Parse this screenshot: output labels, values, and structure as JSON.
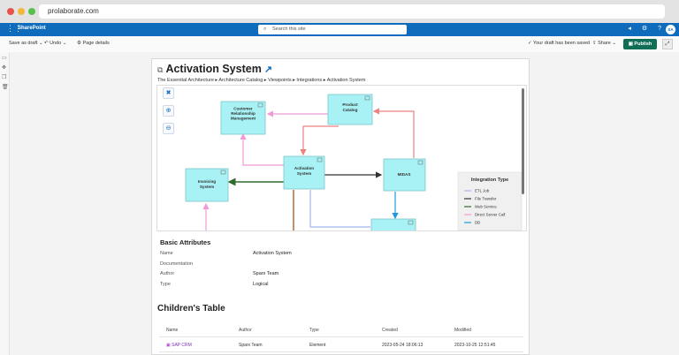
{
  "browser": {
    "url": "prolaborate.com",
    "colors": [
      "#e9524a",
      "#f0b73a",
      "#57c14d"
    ]
  },
  "suite": {
    "app_name": "SharePoint",
    "search_placeholder": "Search this site",
    "avatar": "SA"
  },
  "command_bar": {
    "save_as_draft": "Save as draft",
    "undo": "Undo",
    "page_details": "Page details",
    "draft_status": "Your draft has been saved",
    "share": "Share",
    "publish": "Publish"
  },
  "page": {
    "title": "Activation System",
    "breadcrumb": [
      "The Essential Architecture",
      "Architecture Catalog",
      "Viewpoints",
      "Integrations",
      "Activation System"
    ]
  },
  "diagram": {
    "nodes": [
      "Customer Relationship Management",
      "Product Catalog",
      "Activation System",
      "Invoicing System",
      "MIDAS"
    ],
    "legend": {
      "title": "Integration Type",
      "items": [
        {
          "label": "ETL Job",
          "color": "#9fb7e6"
        },
        {
          "label": "File Transfer",
          "color": "#333333"
        },
        {
          "label": "Web Service",
          "color": "#2e6b2e"
        },
        {
          "label": "Direct Server Call",
          "color": "#f09ad8"
        },
        {
          "label": "DB",
          "color": "#1e9be0"
        }
      ]
    }
  },
  "basic_attributes": {
    "heading": "Basic Attributes",
    "rows": [
      {
        "label": "Name",
        "value": "Activation System"
      },
      {
        "label": "Documentation",
        "value": ""
      },
      {
        "label": "Author",
        "value": "Sparx Team"
      },
      {
        "label": "Type",
        "value": "Logical"
      }
    ]
  },
  "children_table": {
    "heading": "Children's Table",
    "columns": [
      "Name",
      "Author",
      "Type",
      "Created",
      "Modified"
    ],
    "rows": [
      [
        "SAP CRM",
        "Sparx Team",
        "Element",
        "2023-05-24 18:06:13",
        "2023-10-25 12:51:45"
      ]
    ]
  }
}
